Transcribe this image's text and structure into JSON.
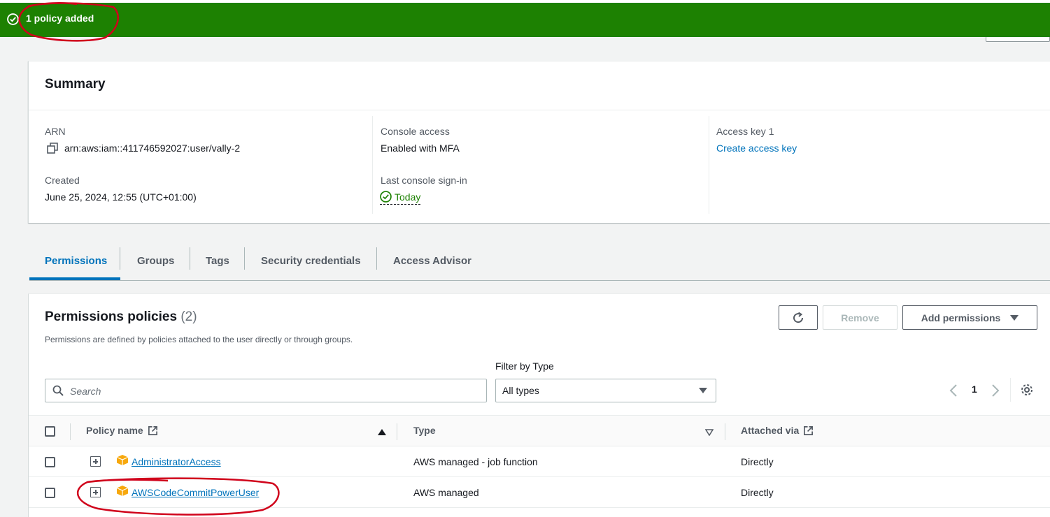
{
  "flash": {
    "message": "1 policy added",
    "color": "#1d8102"
  },
  "summary": {
    "title": "Summary",
    "arn_label": "ARN",
    "arn_value": "arn:aws:iam::411746592027:user/vally-2",
    "created_label": "Created",
    "created_value": "June 25, 2024, 12:55 (UTC+01:00)",
    "console_access_label": "Console access",
    "console_access_value": "Enabled with MFA",
    "last_signin_label": "Last console sign-in",
    "last_signin_value": "Today",
    "access_key_label": "Access key 1",
    "access_key_link": "Create access key"
  },
  "tabs": [
    {
      "label": "Permissions",
      "active": true
    },
    {
      "label": "Groups"
    },
    {
      "label": "Tags"
    },
    {
      "label": "Security credentials"
    },
    {
      "label": "Access Advisor"
    }
  ],
  "permissions": {
    "title": "Permissions policies",
    "count": "(2)",
    "description": "Permissions are defined by policies attached to the user directly or through groups.",
    "refresh_icon": "refresh-icon",
    "remove_label": "Remove",
    "add_label": "Add permissions",
    "filter_label": "Filter by Type",
    "search_placeholder": "Search",
    "filter_value": "All types",
    "page_number": "1",
    "columns": {
      "policy_name": "Policy name",
      "type": "Type",
      "attached_via": "Attached via"
    },
    "rows": [
      {
        "name": "AdministratorAccess",
        "type": "AWS managed - job function",
        "attached": "Directly"
      },
      {
        "name": "AWSCodeCommitPowerUser",
        "type": "AWS managed",
        "attached": "Directly"
      }
    ]
  },
  "colors": {
    "link": "#0073bb",
    "success": "#1d8102",
    "annotation": "#d0021b"
  }
}
